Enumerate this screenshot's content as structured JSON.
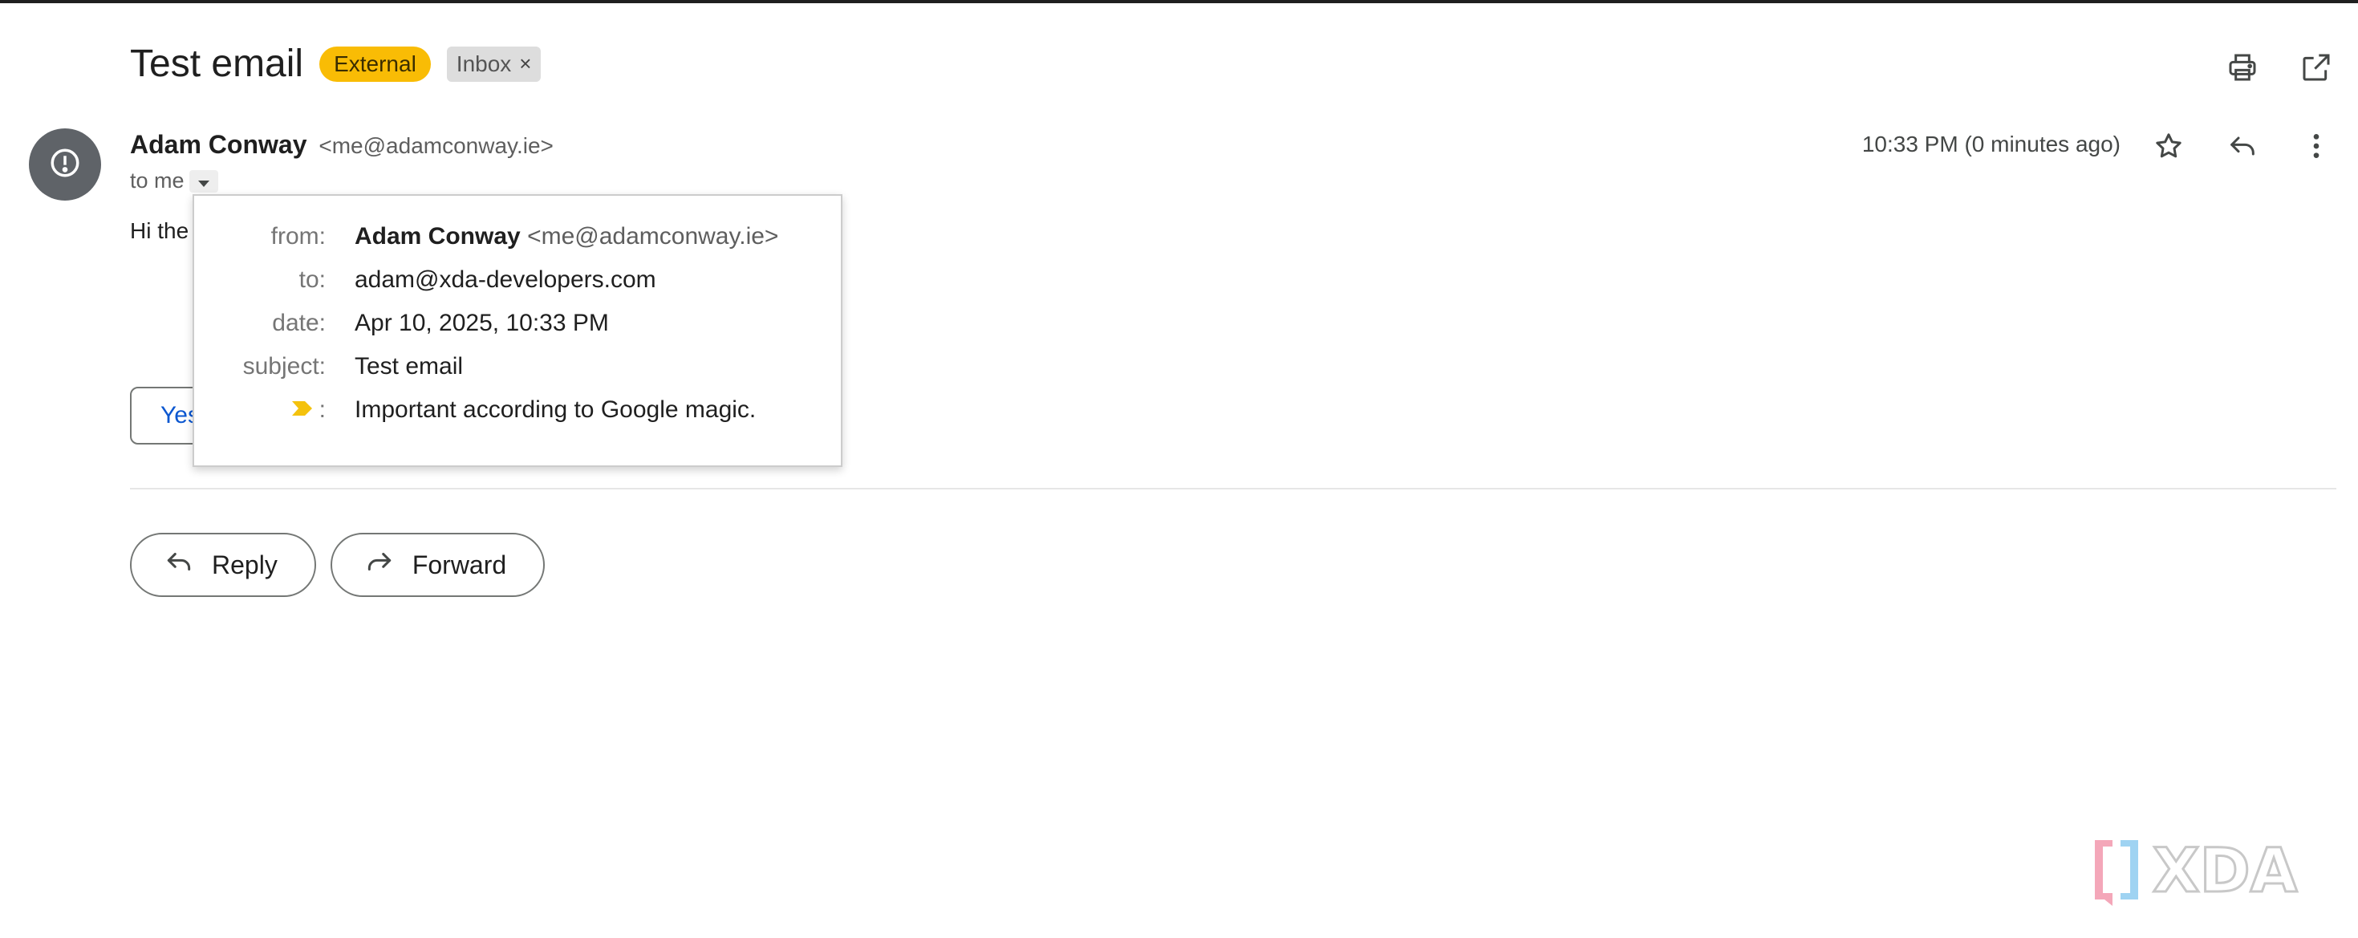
{
  "email": {
    "subject": "Test email",
    "labels": {
      "external": "External",
      "inbox": "Inbox",
      "remove": "×"
    }
  },
  "sender": {
    "name": "Adam Conway",
    "email": "<me@adamconway.ie>",
    "recipient_summary": "to me"
  },
  "timestamp": "10:33 PM (0 minutes ago)",
  "body": {
    "preview": "Hi the",
    "smart_reply_partial": "Yes"
  },
  "details_popup": {
    "from_label": "from:",
    "from_name": "Adam Conway",
    "from_email": "<me@adamconway.ie>",
    "to_label": "to:",
    "to_value": "adam@xda-developers.com",
    "date_label": "date:",
    "date_value": "Apr 10, 2025, 10:33 PM",
    "subject_label": "subject:",
    "subject_value": "Test email",
    "importance_colon": ":",
    "importance_value": "Important according to Google magic."
  },
  "actions": {
    "reply": "Reply",
    "forward": "Forward"
  },
  "icons": {
    "print": "print-icon",
    "open_in_new": "open-in-new-window-icon",
    "star": "star-icon",
    "reply": "reply-icon",
    "more": "more-vertical-icon",
    "warning": "exclamation-circle-icon",
    "importance": "importance-marker-icon"
  },
  "watermark": {
    "text": "XDA"
  },
  "colors": {
    "external_chip": "#f9bc05",
    "inbox_chip": "#dddddd",
    "avatar": "#5f6368",
    "importance_marker": "#f4c20d",
    "link_blue": "#0b57d0"
  }
}
